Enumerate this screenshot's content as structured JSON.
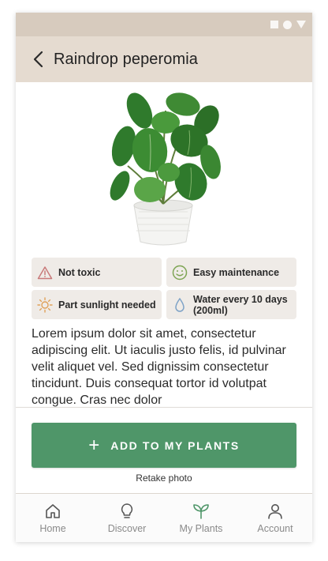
{
  "app": {
    "title": "Raindrop peperomia"
  },
  "chips": [
    {
      "label": "Not toxic",
      "icon": "warning-triangle-icon",
      "color": "#c97a7a"
    },
    {
      "label": "Easy maintenance",
      "icon": "smiley-icon",
      "color": "#7ea554"
    },
    {
      "label": "Part sunlight needed",
      "icon": "sun-icon",
      "color": "#e0a15a"
    },
    {
      "label": "Water every 10 days (200ml)",
      "icon": "water-drop-icon",
      "color": "#7fa3c7"
    }
  ],
  "description": "Lorem ipsum dolor sit amet, consectetur adipiscing elit. Ut iaculis justo felis, id pulvinar velit aliquet vel. Sed dignissim consectetur tincidunt. Duis consequat tortor id volutpat congue. Cras nec dolor",
  "actions": {
    "add_label": "ADD TO MY PLANTS",
    "retake_label": "Retake photo"
  },
  "nav": [
    {
      "label": "Home",
      "icon": "home-icon"
    },
    {
      "label": "Discover",
      "icon": "lightbulb-icon"
    },
    {
      "label": "My Plants",
      "icon": "sprout-icon",
      "active": true
    },
    {
      "label": "Account",
      "icon": "person-icon"
    }
  ],
  "colors": {
    "statusbar": "#d7cbbe",
    "appbar": "#e5dbd0",
    "chip_bg": "#efebe7",
    "primary_button": "#4f9669",
    "active_nav_icon": "#4f9669"
  }
}
